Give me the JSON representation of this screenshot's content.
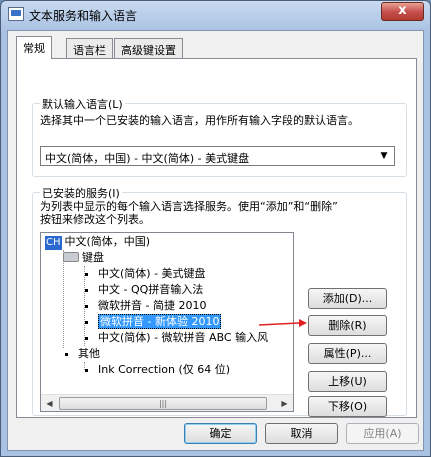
{
  "window": {
    "title": "文本服务和输入语言",
    "close_label": "x"
  },
  "tabs": [
    {
      "label": "常规",
      "active": true
    },
    {
      "label": "语言栏",
      "active": false
    },
    {
      "label": "高级键设置",
      "active": false
    }
  ],
  "default_language": {
    "group_label": "默认输入语言(L)",
    "description": "选择其中一个已安装的输入语言，用作所有输入字段的默认语言。",
    "selected": "中文(简体，中国) - 中文(简体) - 美式键盘"
  },
  "installed_services": {
    "group_label": "已安装的服务(I)",
    "description_line1": "为列表中显示的每个输入语言选择服务。使用“添加”和“删除”",
    "description_line2": "按钮来修改这个列表。",
    "tree": {
      "language_code": "CH",
      "language_label": "中文(简体，中国)",
      "keyboard_label": "键盘",
      "keyboards": [
        {
          "label": "中文(简体) - 美式键盘",
          "selected": false
        },
        {
          "label": "中文 - QQ拼音输入法",
          "selected": false
        },
        {
          "label": "微软拼音 - 简捷 2010",
          "selected": false
        },
        {
          "label": "微软拼音 - 新体验 2010",
          "selected": true
        },
        {
          "label": "中文(简体) - 微软拼音 ABC 输入风",
          "selected": false
        }
      ],
      "other_label": "其他",
      "others": [
        {
          "label": "Ink Correction (仅 64 位)"
        }
      ]
    },
    "buttons": {
      "add": "添加(D)...",
      "remove": "删除(R)",
      "properties": "属性(P)...",
      "move_up": "上移(U)",
      "move_down": "下移(O)"
    }
  },
  "footer": {
    "ok": "确定",
    "cancel": "取消",
    "apply": "应用(A)"
  },
  "colors": {
    "selection": "#3399ff",
    "arrow": "#e02020",
    "badge": "#2a6ad0"
  },
  "icons": {
    "scroll_left": "◀",
    "scroll_right": "▶",
    "thumb_grip": "|||",
    "dropdown": "▼"
  }
}
